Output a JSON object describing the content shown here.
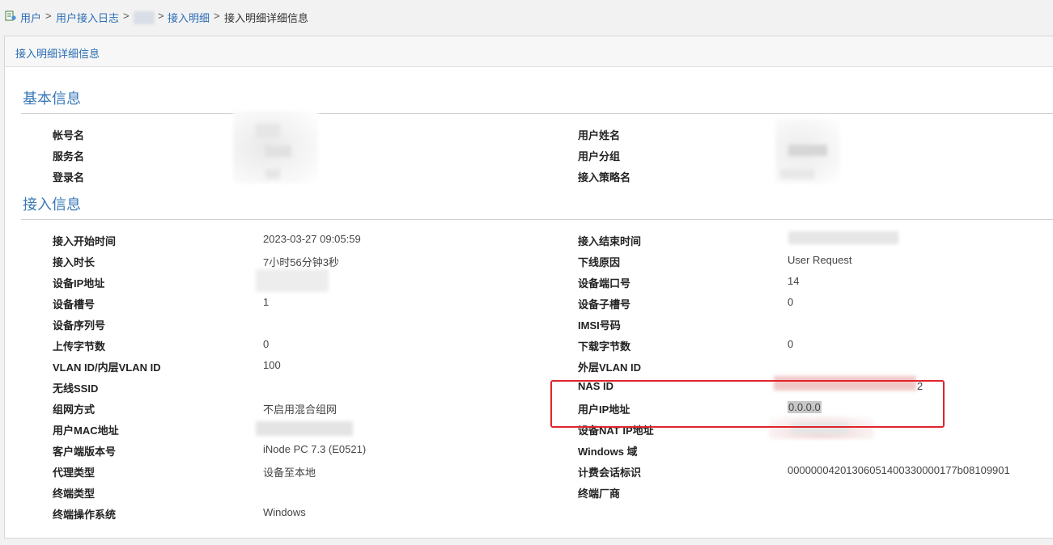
{
  "breadcrumb": {
    "items": [
      "用户",
      "用户接入日志",
      "接入明细",
      "接入明细详细信息"
    ],
    "separator": ">"
  },
  "panel": {
    "title": "接入明细详细信息"
  },
  "sections": {
    "basic": {
      "title": "基本信息",
      "left": [
        {
          "label": "帐号名",
          "value": ""
        },
        {
          "label": "服务名",
          "value": ""
        },
        {
          "label": "登录名",
          "value": ""
        }
      ],
      "right": [
        {
          "label": "用户姓名",
          "value": ""
        },
        {
          "label": "用户分组",
          "value": ""
        },
        {
          "label": "接入策略名",
          "value": ""
        }
      ]
    },
    "access": {
      "title": "接入信息",
      "left": [
        {
          "label": "接入开始时间",
          "value": "2023-03-27 09:05:59"
        },
        {
          "label": "接入时长",
          "value": "7小时56分钟3秒"
        },
        {
          "label": "设备IP地址",
          "value": ""
        },
        {
          "label": "设备槽号",
          "value": "1"
        },
        {
          "label": "设备序列号",
          "value": ""
        },
        {
          "label": "上传字节数",
          "value": "0"
        },
        {
          "label": "VLAN ID/内层VLAN ID",
          "value": "100"
        },
        {
          "label": "无线SSID",
          "value": ""
        },
        {
          "label": "组网方式",
          "value": "不启用混合组网"
        },
        {
          "label": "用户MAC地址",
          "value": ""
        },
        {
          "label": "客户端版本号",
          "value": "iNode PC 7.3 (E0521)"
        },
        {
          "label": "代理类型",
          "value": "设备至本地"
        },
        {
          "label": "终端类型",
          "value": ""
        },
        {
          "label": "终端操作系统",
          "value": "Windows"
        }
      ],
      "right": [
        {
          "label": "接入结束时间",
          "value": ""
        },
        {
          "label": "下线原因",
          "value": "User Request"
        },
        {
          "label": "设备端口号",
          "value": "14"
        },
        {
          "label": "设备子槽号",
          "value": "0"
        },
        {
          "label": "IMSI号码",
          "value": ""
        },
        {
          "label": "下载字节数",
          "value": "0"
        },
        {
          "label": "外层VLAN ID",
          "value": ""
        },
        {
          "label": "NAS ID",
          "value": "2"
        },
        {
          "label": "用户IP地址",
          "value": "0.0.0.0"
        },
        {
          "label": "设备NAT IP地址",
          "value": ""
        },
        {
          "label": "Windows 域",
          "value": ""
        },
        {
          "label": "计费会话标识",
          "value": "00000004201306051400330000177b08109901"
        },
        {
          "label": "终端厂商",
          "value": ""
        }
      ]
    }
  },
  "colors": {
    "link": "#2a6db5",
    "section": "#3a78b8",
    "highlight": "#e0242b"
  },
  "icons": {
    "home": "user-log-icon"
  }
}
